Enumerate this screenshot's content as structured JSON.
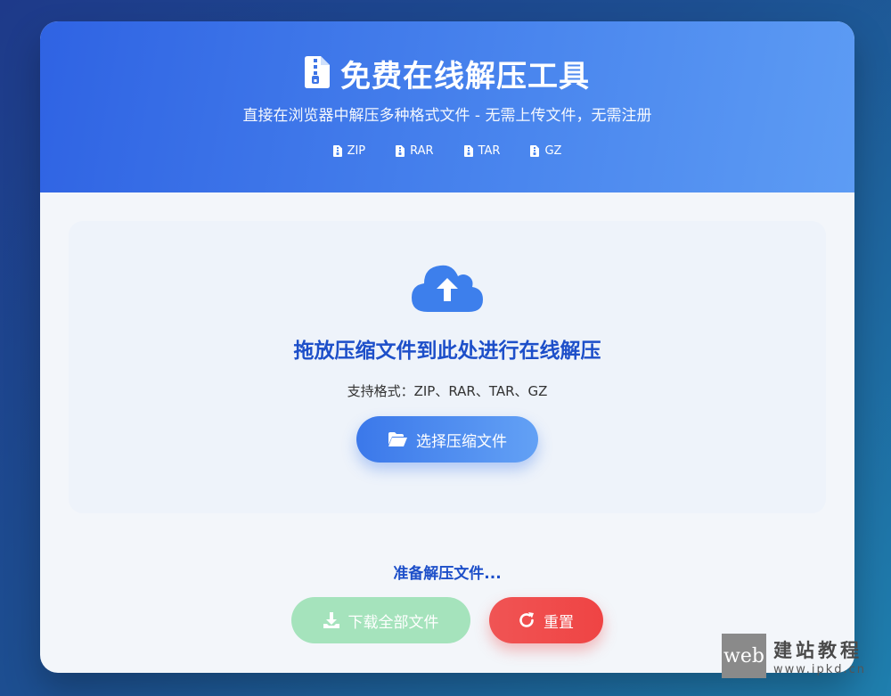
{
  "header": {
    "title": "免费在线解压工具",
    "subtitle": "直接在浏览器中解压多种格式文件 - 无需上传文件，无需注册",
    "formats": [
      "ZIP",
      "RAR",
      "TAR",
      "GZ"
    ]
  },
  "drop_zone": {
    "title": "拖放压缩文件到此处进行在线解压",
    "hint": "支持格式：ZIP、RAR、TAR、GZ",
    "select_button": "选择压缩文件"
  },
  "status": "准备解压文件...",
  "actions": {
    "download_all": "下载全部文件",
    "reset": "重置"
  },
  "watermark": {
    "box": "web",
    "cn": "建站教程",
    "url": "www.ipkd.cn"
  },
  "colors": {
    "accent": "#3b78ea",
    "title_blue": "#1d4fc9",
    "success_disabled": "#a5e3bc",
    "danger": "#ef4444"
  },
  "icons": {
    "title": "file-archive-icon",
    "format": "file-icon",
    "upload": "cloud-upload-icon",
    "select": "folder-open-icon",
    "download": "download-icon",
    "reset": "redo-icon"
  }
}
